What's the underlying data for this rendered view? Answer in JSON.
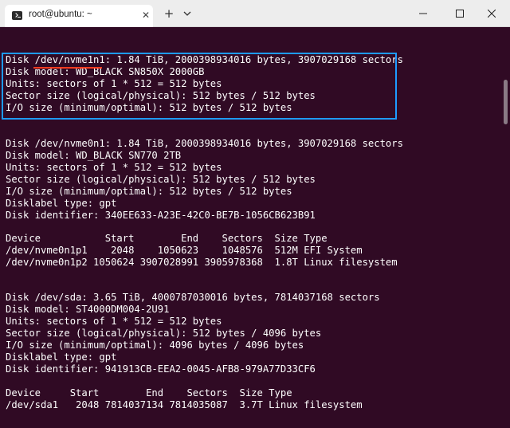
{
  "window": {
    "tab_title": "root@ubuntu: ~",
    "tab_close_glyph": "✕",
    "new_tab_glyph": "+",
    "icons": {
      "tab_icon": "terminal-icon",
      "dropdown": "chevron-down-icon",
      "minimize": "minimize-icon",
      "maximize": "maximize-icon",
      "close": "close-icon"
    }
  },
  "colors": {
    "terminal_bg": "#300a24",
    "terminal_fg": "#ffffff",
    "highlight_box": "#1e9bff",
    "underline": "#ff3b1f"
  },
  "terminal": {
    "lines": [
      "Disk /dev/nvme1n1: 1.84 TiB, 2000398934016 bytes, 3907029168 sectors",
      "Disk model: WD_BLACK SN850X 2000GB",
      "Units: sectors of 1 * 512 = 512 bytes",
      "Sector size (logical/physical): 512 bytes / 512 bytes",
      "I/O size (minimum/optimal): 512 bytes / 512 bytes",
      "",
      "",
      "Disk /dev/nvme0n1: 1.84 TiB, 2000398934016 bytes, 3907029168 sectors",
      "Disk model: WD_BLACK SN770 2TB",
      "Units: sectors of 1 * 512 = 512 bytes",
      "Sector size (logical/physical): 512 bytes / 512 bytes",
      "I/O size (minimum/optimal): 512 bytes / 512 bytes",
      "Disklabel type: gpt",
      "Disk identifier: 340EE633-A23E-42C0-BE7B-1056CB623B91",
      "",
      "Device           Start        End    Sectors  Size Type",
      "/dev/nvme0n1p1    2048    1050623    1048576  512M EFI System",
      "/dev/nvme0n1p2 1050624 3907028991 3905978368  1.8T Linux filesystem",
      "",
      "",
      "Disk /dev/sda: 3.65 TiB, 4000787030016 bytes, 7814037168 sectors",
      "Disk model: ST4000DM004-2U91",
      "Units: sectors of 1 * 512 = 512 bytes",
      "Sector size (logical/physical): 512 bytes / 4096 bytes",
      "I/O size (minimum/optimal): 4096 bytes / 4096 bytes",
      "Disklabel type: gpt",
      "Disk identifier: 941913CB-EEA2-0045-AFB8-979A77D33CF6",
      "",
      "Device     Start        End    Sectors  Size Type",
      "/dev/sda1   2048 7814037134 7814035087  3.7T Linux filesystem"
    ]
  }
}
